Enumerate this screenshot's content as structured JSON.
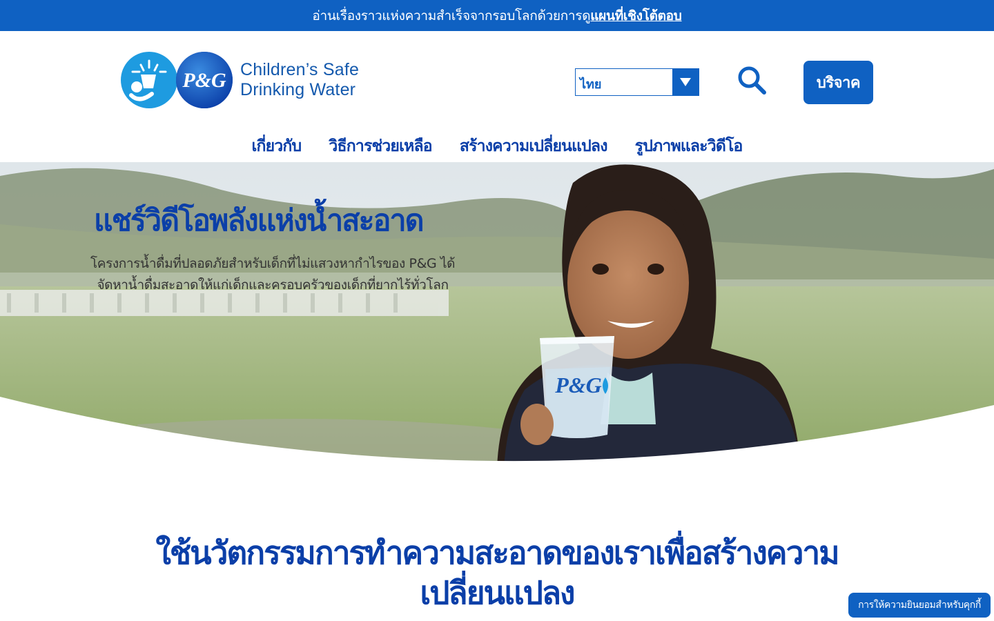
{
  "announcement": {
    "text": "อ่านเรื่องราวแห่งความสำเร็จจากรอบโลกด้วยการดู",
    "link": "แผนที่เชิงโต้ตอบ"
  },
  "logo": {
    "brand": "P&G",
    "line1": "Children’s Safe",
    "line2": "Drinking Water"
  },
  "language": {
    "selected": "ไทย"
  },
  "donate_label": "บริจาค",
  "nav": {
    "items": [
      {
        "label": "เกี่ยวกับ"
      },
      {
        "label": "วิธีการช่วยเหลือ"
      },
      {
        "label": "สร้างความเปลี่ยนแปลง"
      },
      {
        "label": "รูปภาพและวิดีโอ"
      }
    ]
  },
  "hero": {
    "title": "แชร์วิดีโอพลังแห่งน้ำสะอาด",
    "subtitle": "โครงการน้ำดื่มที่ปลอดภัยสำหรับเด็กที่ไม่แสวงหากำไรของ P&G ได้จัดหาน้ำดื่มสะอาดให้แก่เด็กและครอบครัวของเด็กที่ยากไร้ทั่วโลก",
    "cup_brand": "P&G"
  },
  "section": {
    "title": "ใช้นวัตกรรมการทำความสะอาดของเราเพื่อสร้างความเปลี่ยนแปลง"
  },
  "cookie_label": "การให้ความยินยอมสำหรับคุกกี้",
  "colors": {
    "primary": "#0f61c2",
    "heading": "#0b3fa8",
    "logo_light": "#1e9be0"
  },
  "icons": {
    "search": "search-icon",
    "dropdown": "chevron-down-icon"
  }
}
